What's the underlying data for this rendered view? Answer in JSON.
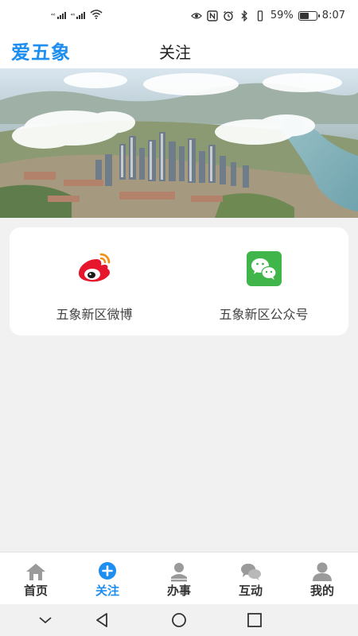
{
  "status_bar": {
    "signal_1_label": "⁴⁶",
    "signal_2_label": "⁴⁶",
    "battery_percent": "59%",
    "battery_level": 0.59,
    "time": "8:07"
  },
  "header": {
    "app_logo": "爱五象",
    "title": "关注"
  },
  "follow_card": {
    "items": [
      {
        "label": "五象新区微博",
        "icon": "weibo-icon"
      },
      {
        "label": "五象新区公众号",
        "icon": "wechat-icon"
      }
    ]
  },
  "tab_bar": {
    "tabs": [
      {
        "label": "首页",
        "icon": "home-icon",
        "active": false
      },
      {
        "label": "关注",
        "icon": "plus-circle-icon",
        "active": true
      },
      {
        "label": "办事",
        "icon": "service-person-icon",
        "active": false
      },
      {
        "label": "互动",
        "icon": "chat-bubbles-icon",
        "active": false
      },
      {
        "label": "我的",
        "icon": "user-icon",
        "active": false
      }
    ]
  },
  "colors": {
    "accent": "#1e8ef0",
    "background": "#f1f1f1",
    "weibo_red": "#e6162d",
    "wechat_green": "#3fb54a"
  }
}
